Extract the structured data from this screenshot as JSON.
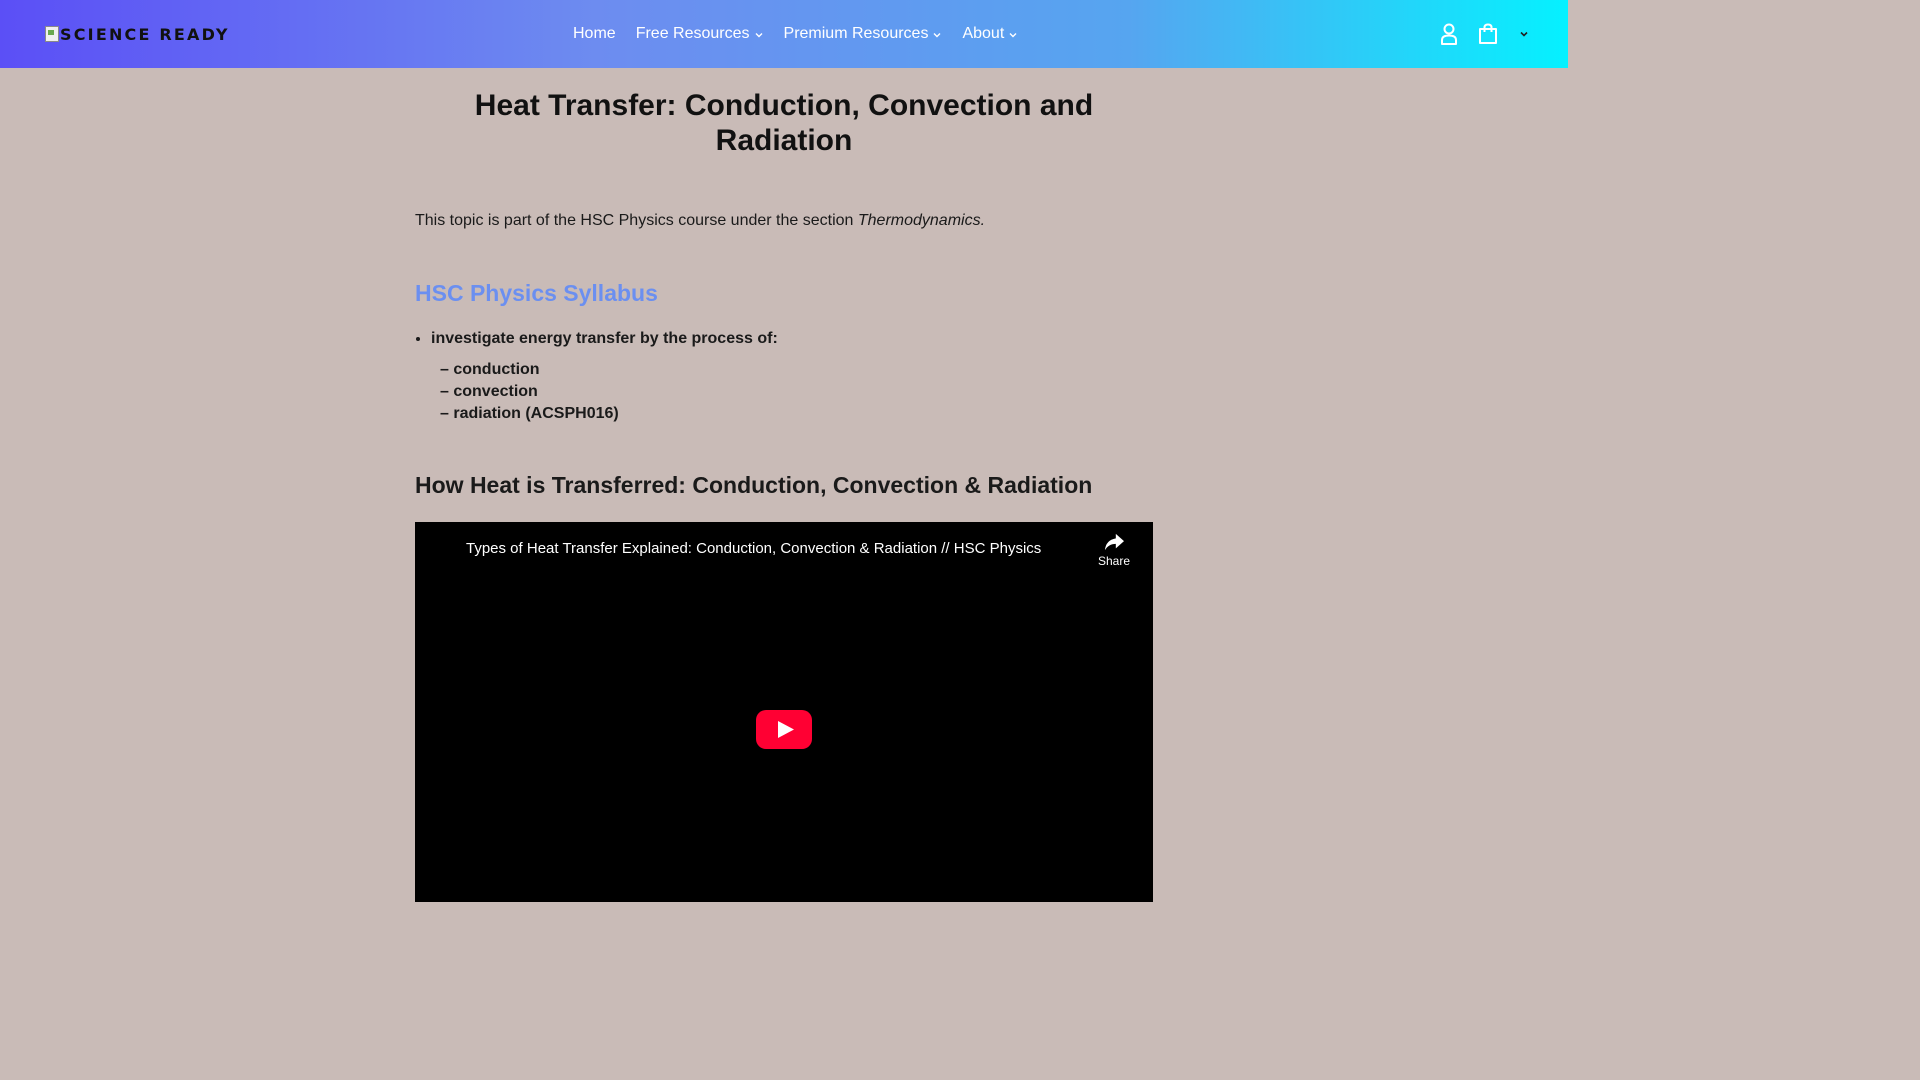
{
  "header": {
    "logo_text": "SCIENCE READY",
    "nav": [
      {
        "label": "Home"
      },
      {
        "label": "Free Resources"
      },
      {
        "label": "Premium Resources"
      },
      {
        "label": "About"
      }
    ],
    "icons": {
      "account": "account-icon",
      "cart": "shopping-bag-icon",
      "currency": "chevron-down-icon"
    },
    "gradient_colors": [
      "#5b4ff6",
      "#6d8cf0",
      "#56a5f0",
      "#05f1ff"
    ]
  },
  "article": {
    "title": "Heat Transfer: Conduction, Convection and Radiation",
    "intro_text": "This topic is part of the HSC Physics course under the section ",
    "intro_section": "Thermodynamics.",
    "syllabus_heading": "HSC Physics Syllabus",
    "syllabus_item": "investigate energy transfer by the process of:",
    "sub_items": [
      "– conduction",
      "– convection",
      "– radiation (ACSPH016)"
    ],
    "section_heading": "How Heat is Transferred: Conduction, Convection & Radiation"
  },
  "video": {
    "title": "Types of Heat Transfer Explained: Conduction, Convection & Radiation // HSC Physics",
    "share_label": "Share",
    "play_color": "#ff0033"
  },
  "colors": {
    "background": "#c9bbb7",
    "syllabus_heading": "#6b8ff0"
  }
}
